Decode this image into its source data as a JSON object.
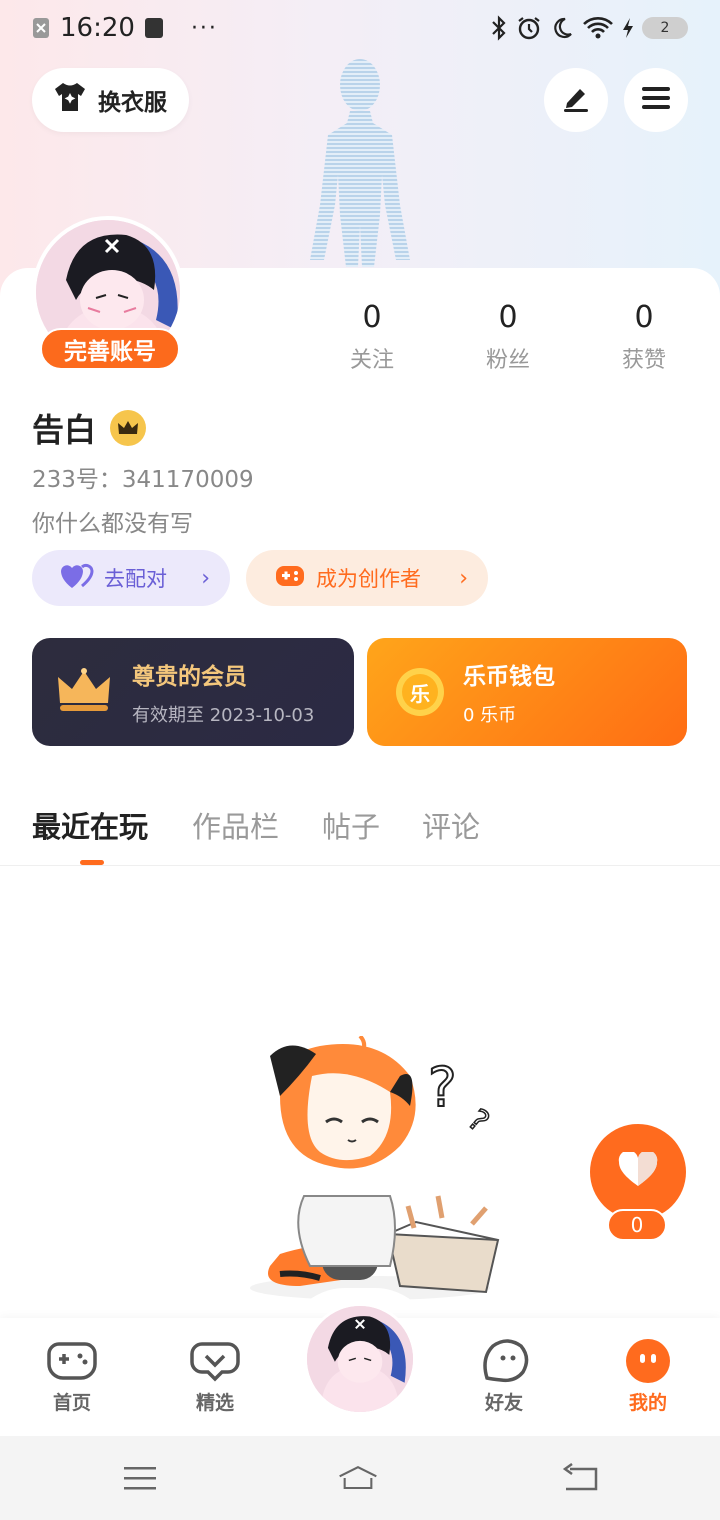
{
  "status_bar": {
    "time": "16:20",
    "more": "···",
    "battery_level": "2"
  },
  "header": {
    "wardrobe_label": "换衣服"
  },
  "profile": {
    "complete_account_label": "完善账号",
    "stats": [
      {
        "value": "0",
        "label": "关注"
      },
      {
        "value": "0",
        "label": "粉丝"
      },
      {
        "value": "0",
        "label": "获赞"
      }
    ],
    "name": "告白",
    "id_line": "233号：341170009",
    "bio": "你什么都没有写"
  },
  "actions": {
    "match_label": "去配对",
    "creator_label": "成为创作者",
    "chevron": "›"
  },
  "cards": {
    "vip": {
      "title": "尊贵的会员",
      "subtitle": "有效期至 2023-10-03"
    },
    "wallet": {
      "title": "乐币钱包",
      "subtitle": "0 乐币",
      "coin_glyph": "乐"
    }
  },
  "tabs": [
    {
      "label": "最近在玩",
      "active": true
    },
    {
      "label": "作品栏",
      "active": false
    },
    {
      "label": "帖子",
      "active": false
    },
    {
      "label": "评论",
      "active": false
    }
  ],
  "like_fab": {
    "count": "0"
  },
  "bottom_nav": [
    {
      "label": "首页",
      "icon": "gamepad-icon"
    },
    {
      "label": "精选",
      "icon": "heart-chat-icon"
    },
    {
      "label": "",
      "icon": "avatar"
    },
    {
      "label": "好友",
      "icon": "friend-face-icon"
    },
    {
      "label": "我的",
      "icon": "me-face-icon",
      "active": true
    }
  ],
  "colors": {
    "accent": "#ff6b1e",
    "vip_gold": "#f4c77c",
    "match_purple": "#6a5fd6"
  }
}
